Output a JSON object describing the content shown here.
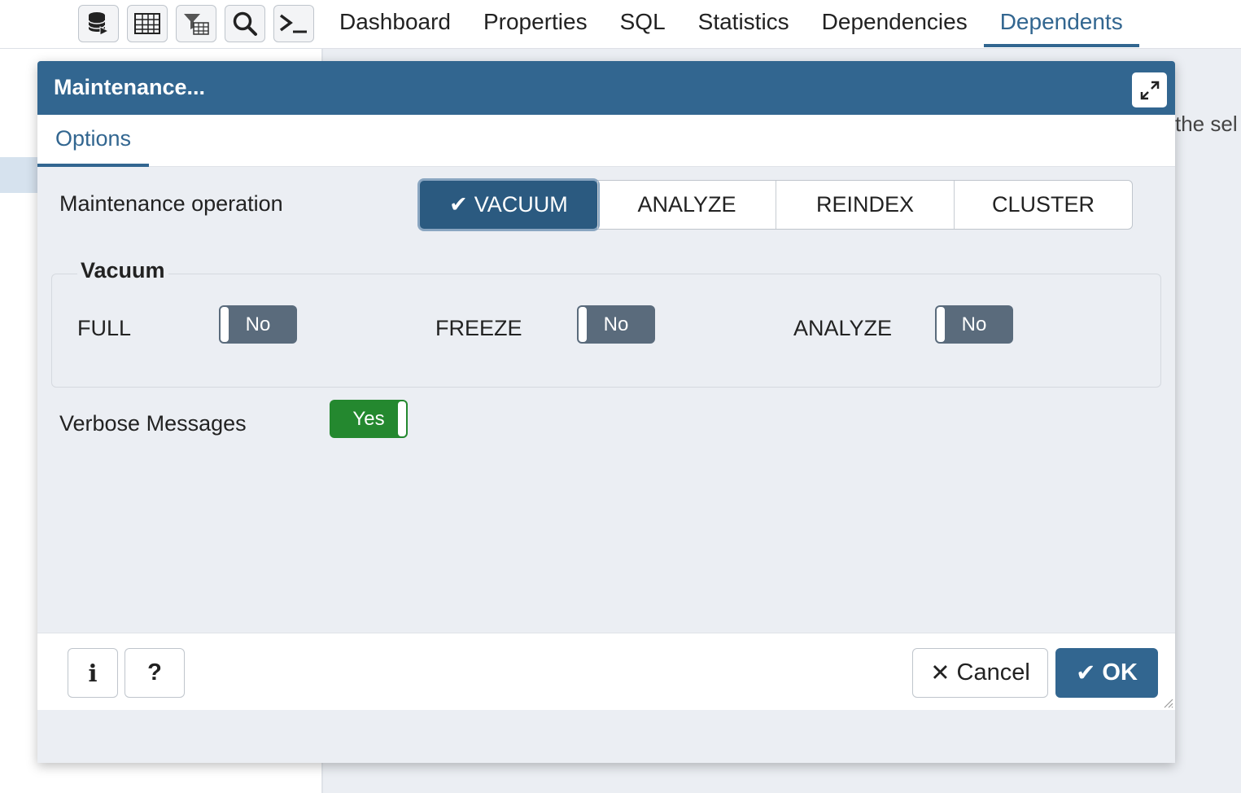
{
  "toolbar": {
    "icons": [
      "database-query-icon",
      "table-icon",
      "filtered-rows-icon",
      "search-icon",
      "terminal-icon"
    ]
  },
  "tabs": [
    {
      "label": "Dashboard",
      "active": false
    },
    {
      "label": "Properties",
      "active": false
    },
    {
      "label": "SQL",
      "active": false
    },
    {
      "label": "Statistics",
      "active": false
    },
    {
      "label": "Dependencies",
      "active": false
    },
    {
      "label": "Dependents",
      "active": true
    }
  ],
  "background": {
    "partial_text": "the sel"
  },
  "dialog": {
    "title": "Maintenance...",
    "tab": "Options",
    "operation_label": "Maintenance operation",
    "operations": [
      {
        "label": "VACUUM",
        "active": true
      },
      {
        "label": "ANALYZE",
        "active": false
      },
      {
        "label": "REINDEX",
        "active": false
      },
      {
        "label": "CLUSTER",
        "active": false
      }
    ],
    "vacuum": {
      "legend": "Vacuum",
      "full_label": "FULL",
      "full_value": "No",
      "freeze_label": "FREEZE",
      "freeze_value": "No",
      "analyze_label": "ANALYZE",
      "analyze_value": "No"
    },
    "verbose_label": "Verbose Messages",
    "verbose_value": "Yes",
    "footer": {
      "info_label": "i",
      "help_label": "?",
      "cancel_label": "Cancel",
      "ok_label": "OK"
    }
  },
  "colors": {
    "accent": "#326690",
    "toggle_off": "#5a6b7c",
    "toggle_on": "#24882f"
  }
}
